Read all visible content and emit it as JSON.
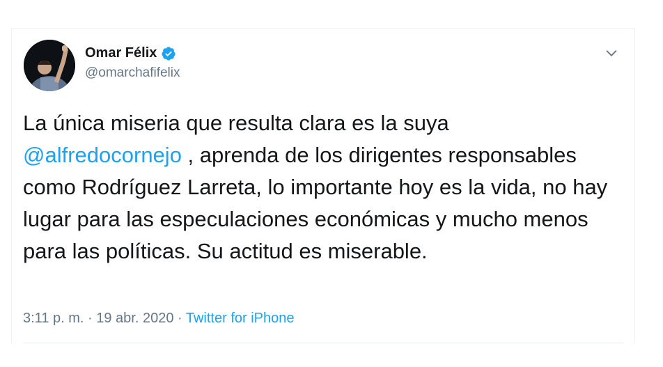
{
  "author": {
    "display_name": "Omar Félix",
    "handle": "@omarchafifelix",
    "verified": true
  },
  "tweet": {
    "line1": "La única miseria que resulta clara es la suya",
    "mention": "@alfredocornejo",
    "rest": " , aprenda de los dirigentes responsables como Rodríguez Larreta, lo importante hoy es la vida, no hay lugar para las especulaciones económicas y mucho menos para las políticas. Su actitud es miserable."
  },
  "meta": {
    "time": "3:11 p. m.",
    "separator": " · ",
    "date": "19 abr. 2020",
    "source": "Twitter for iPhone"
  },
  "colors": {
    "accent": "#1da1f2",
    "text": "#14171a",
    "secondary": "#657786"
  },
  "icons": {
    "verified": "verified-badge-icon",
    "menu": "chevron-down-icon"
  }
}
